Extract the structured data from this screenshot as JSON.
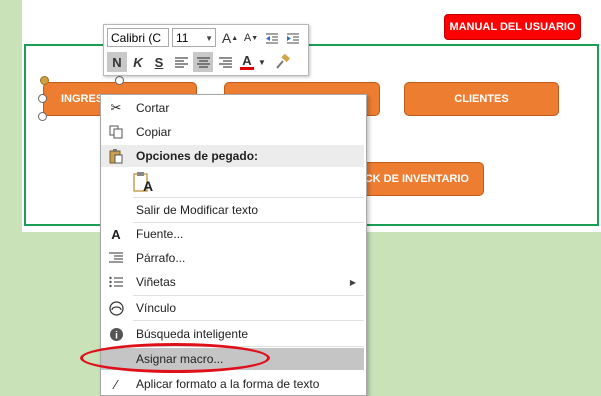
{
  "manual_button": "MANUAL DEL USUARIO",
  "buttons": {
    "ingresos": "INGRES",
    "middle": "",
    "clientes": "CLIENTES",
    "stock": "CK DE INVENTARIO"
  },
  "mini_toolbar": {
    "font_name": "Calibri (C",
    "font_size": "11",
    "bold": "N",
    "italic": "K",
    "strike": "S",
    "font_color": "A"
  },
  "menu": {
    "cut": "Cortar",
    "copy": "Copiar",
    "paste_options": "Opciones de pegado:",
    "paste_glyph": "A",
    "exit_edit": "Salir de Modificar texto",
    "font": "Fuente...",
    "paragraph": "Párrafo...",
    "bullets": "Viñetas",
    "link": "Vínculo",
    "smart_lookup": "Búsqueda inteligente",
    "assign_macro": "Asignar macro...",
    "format_shape": "Aplicar formato a la forma de texto"
  },
  "colors": {
    "orange": "#ed7d31",
    "red": "#ff0000",
    "green_border": "#1a9e55",
    "annotation": "#e0101a"
  }
}
